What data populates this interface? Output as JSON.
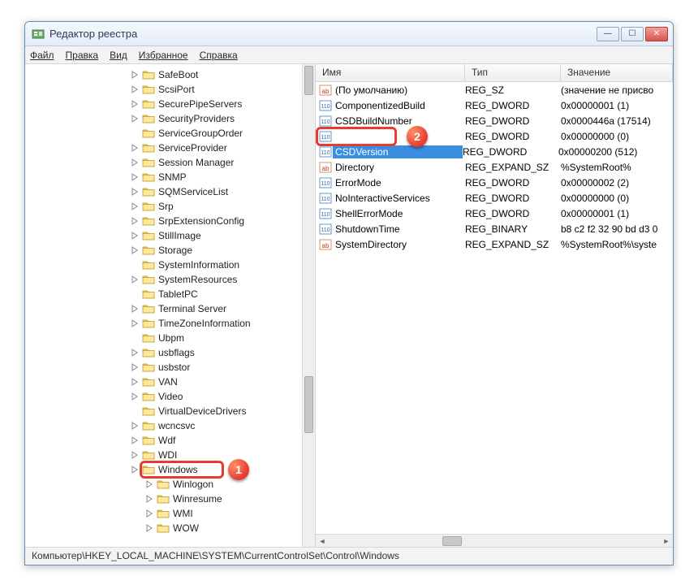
{
  "window": {
    "title": "Редактор реестра"
  },
  "menu": {
    "file": "Файл",
    "edit": "Правка",
    "view": "Вид",
    "favorites": "Избранное",
    "help": "Справка"
  },
  "tree": {
    "items": [
      {
        "label": "SafeBoot",
        "expandable": true
      },
      {
        "label": "ScsiPort",
        "expandable": true
      },
      {
        "label": "SecurePipeServers",
        "expandable": true
      },
      {
        "label": "SecurityProviders",
        "expandable": true
      },
      {
        "label": "ServiceGroupOrder",
        "expandable": false
      },
      {
        "label": "ServiceProvider",
        "expandable": true
      },
      {
        "label": "Session Manager",
        "expandable": true
      },
      {
        "label": "SNMP",
        "expandable": true
      },
      {
        "label": "SQMServiceList",
        "expandable": true
      },
      {
        "label": "Srp",
        "expandable": true
      },
      {
        "label": "SrpExtensionConfig",
        "expandable": true
      },
      {
        "label": "StillImage",
        "expandable": true
      },
      {
        "label": "Storage",
        "expandable": true
      },
      {
        "label": "SystemInformation",
        "expandable": false
      },
      {
        "label": "SystemResources",
        "expandable": true
      },
      {
        "label": "TabletPC",
        "expandable": false
      },
      {
        "label": "Terminal Server",
        "expandable": true
      },
      {
        "label": "TimeZoneInformation",
        "expandable": true
      },
      {
        "label": "Ubpm",
        "expandable": false
      },
      {
        "label": "usbflags",
        "expandable": true
      },
      {
        "label": "usbstor",
        "expandable": true
      },
      {
        "label": "VAN",
        "expandable": true
      },
      {
        "label": "Video",
        "expandable": true
      },
      {
        "label": "VirtualDeviceDrivers",
        "expandable": false
      },
      {
        "label": "wcncsvc",
        "expandable": true
      },
      {
        "label": "Wdf",
        "expandable": true
      },
      {
        "label": "WDI",
        "expandable": true
      },
      {
        "label": "Windows",
        "expandable": true,
        "selected": true
      },
      {
        "label": "Winlogon",
        "expandable": true,
        "child": true
      },
      {
        "label": "Winresume",
        "expandable": true,
        "child": true
      },
      {
        "label": "WMI",
        "expandable": true,
        "child": true
      },
      {
        "label": "WOW",
        "expandable": true,
        "child": true
      }
    ]
  },
  "columns": {
    "name": "Имя",
    "type": "Тип",
    "value": "Значение"
  },
  "values": [
    {
      "icon": "str",
      "name": "(По умолчанию)",
      "type": "REG_SZ",
      "value": "(значение не присво"
    },
    {
      "icon": "bin",
      "name": "ComponentizedBuild",
      "type": "REG_DWORD",
      "value": "0x00000001 (1)"
    },
    {
      "icon": "bin",
      "name": "CSDBuildNumber",
      "type": "REG_DWORD",
      "value": "0x0000446a (17514)"
    },
    {
      "icon": "bin",
      "name": "",
      "type": "REG_DWORD",
      "value": "0x00000000 (0)"
    },
    {
      "icon": "bin",
      "name": "CSDVersion",
      "type": "REG_DWORD",
      "value": "0x00000200 (512)",
      "selected": true
    },
    {
      "icon": "str",
      "name": "Directory",
      "type": "REG_EXPAND_SZ",
      "value": "%SystemRoot%"
    },
    {
      "icon": "bin",
      "name": "ErrorMode",
      "type": "REG_DWORD",
      "value": "0x00000002 (2)"
    },
    {
      "icon": "bin",
      "name": "NoInteractiveServices",
      "type": "REG_DWORD",
      "value": "0x00000000 (0)"
    },
    {
      "icon": "bin",
      "name": "ShellErrorMode",
      "type": "REG_DWORD",
      "value": "0x00000001 (1)"
    },
    {
      "icon": "bin",
      "name": "ShutdownTime",
      "type": "REG_BINARY",
      "value": "b8 c2 f2 32 90 bd d3 0"
    },
    {
      "icon": "str",
      "name": "SystemDirectory",
      "type": "REG_EXPAND_SZ",
      "value": "%SystemRoot%\\syste"
    }
  ],
  "markers": {
    "m1": "1",
    "m2": "2"
  },
  "status": "Компьютер\\HKEY_LOCAL_MACHINE\\SYSTEM\\CurrentControlSet\\Control\\Windows"
}
